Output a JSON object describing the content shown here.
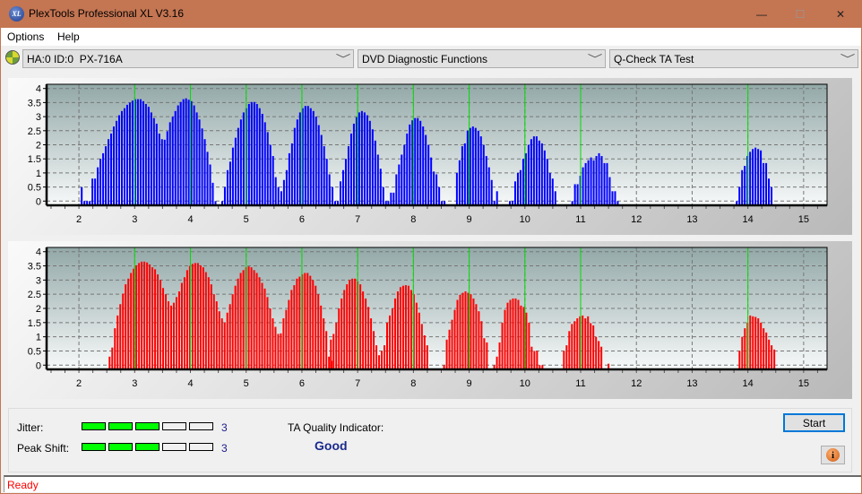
{
  "window": {
    "title": "PlexTools Professional XL V3.16",
    "logo_text": "XL",
    "controls": {
      "minimize": "—",
      "maximize": "☐",
      "close": "✕"
    }
  },
  "menu": {
    "items": [
      {
        "label": "Options"
      },
      {
        "label": "Help"
      }
    ]
  },
  "toolbar": {
    "drive_icon": "disc-drive-icon",
    "drive_select": "HA:0 ID:0  PX-716A",
    "function_select": "DVD Diagnostic Functions",
    "test_select": "Q-Check TA Test",
    "chevron": "﹀"
  },
  "chart_data": [
    {
      "type": "bar",
      "name": "TA land/pit jitter distribution (top)",
      "color": "#0000ff",
      "xlim": [
        1.42,
        15.42
      ],
      "ylim": [
        -0.15,
        4.15
      ],
      "x_ticks": [
        2,
        3,
        4,
        5,
        6,
        7,
        8,
        9,
        10,
        11,
        12,
        13,
        14,
        15
      ],
      "y_ticks": [
        0,
        0.5,
        1,
        1.5,
        2,
        2.5,
        3,
        3.5,
        4
      ],
      "y_tick_labels": [
        "0",
        "0.5",
        "1",
        "1.5",
        "2",
        "2.5",
        "3",
        "3.5",
        "4"
      ],
      "grid": true,
      "reference_lines": [
        3,
        4,
        5,
        6,
        7,
        8,
        9,
        10,
        11,
        14
      ],
      "step": 0.048,
      "clusters": [
        {
          "start": 2.05,
          "values": [
            0.5,
            0,
            0,
            0,
            0.8,
            0.8,
            1.2,
            1.5,
            1.7,
            1.95,
            2.2,
            2.4,
            2.65,
            2.85,
            3.05,
            3.2,
            3.3,
            3.42,
            3.5,
            3.57,
            3.62,
            3.62,
            3.62,
            3.55,
            3.45,
            3.35,
            3.15,
            2.95,
            2.75,
            2.4,
            2.2,
            2.18,
            2.48,
            2.8,
            3.0,
            3.2,
            3.4,
            3.52,
            3.62,
            3.65,
            3.6,
            3.55,
            3.4,
            3.15,
            2.9,
            2.58,
            2.2,
            1.75,
            1.3,
            0.65
          ]
        },
        {
          "start": 4.45,
          "values": [
            0
          ]
        },
        {
          "start": 4.57,
          "values": [
            0,
            0.5,
            1.1,
            1.4,
            1.9,
            2.25,
            2.6,
            2.9,
            3.15,
            3.3,
            3.45,
            3.52,
            3.52,
            3.45,
            3.3,
            3.1,
            2.8,
            2.45,
            2.0,
            1.6,
            0.85,
            0.5
          ]
        },
        {
          "start": 5.63,
          "values": [
            0.35,
            0.75,
            1.1,
            1.7,
            2.05,
            2.6,
            2.9,
            3.15,
            3.3,
            3.38,
            3.38,
            3.3,
            3.2,
            3.0,
            2.7,
            2.35,
            1.95,
            1.5,
            0.95
          ]
        },
        {
          "start": 6.5,
          "values": [
            0.5,
            0.5,
            0,
            0,
            0.7,
            1.1,
            1.5,
            1.95,
            2.4,
            2.75,
            2.98,
            3.15,
            3.2,
            3.15,
            3.05,
            2.85,
            2.55,
            2.15,
            1.65,
            1.15,
            0.5,
            0
          ]
        },
        {
          "start": 7.55,
          "values": [
            0,
            0.3,
            0.3,
            0.95,
            1.3,
            1.65,
            2.0,
            2.4,
            2.72,
            2.87,
            2.95,
            2.95,
            2.85,
            2.65,
            2.35,
            2.0,
            1.55,
            1.05,
            0.95,
            0.5,
            0,
            0
          ]
        },
        {
          "start": 8.78,
          "values": [
            1.0,
            1.45,
            1.95,
            2.05,
            2.5,
            2.6,
            2.65,
            2.6,
            2.5,
            2.3,
            2.0,
            1.6,
            1.2,
            0.75,
            0,
            0.35
          ]
        },
        {
          "start": 9.73,
          "values": [
            0,
            0,
            0.7,
            1.0,
            1.1,
            1.5,
            1.7,
            2.0,
            2.2,
            2.3,
            2.3,
            2.15,
            2.05,
            1.8,
            1.5,
            1.0,
            0.8,
            0.35
          ]
        },
        {
          "start": 10.85,
          "values": [
            0,
            0.6,
            0.6,
            0.9,
            1.2,
            1.35,
            1.45,
            1.55,
            1.45,
            1.6,
            1.7,
            1.6,
            1.35,
            1.35,
            0.85,
            0.35,
            0.35,
            0
          ]
        },
        {
          "start": 13.8,
          "values": [
            0,
            0.5,
            1.1,
            1.25,
            1.6,
            1.75,
            1.85,
            1.9,
            1.85,
            1.8,
            1.35,
            1.35,
            0.8,
            0.5
          ]
        }
      ]
    },
    {
      "type": "bar",
      "name": "TA land/pit jitter distribution (bottom)",
      "color": "#ff0000",
      "xlim": [
        1.42,
        15.42
      ],
      "ylim": [
        -0.15,
        4.15
      ],
      "x_ticks": [
        2,
        3,
        4,
        5,
        6,
        7,
        8,
        9,
        10,
        11,
        12,
        13,
        14,
        15
      ],
      "y_ticks": [
        0,
        0.5,
        1,
        1.5,
        2,
        2.5,
        3,
        3.5,
        4
      ],
      "y_tick_labels": [
        "0",
        "0.5",
        "1",
        "1.5",
        "2",
        "2.5",
        "3",
        "3.5",
        "4"
      ],
      "grid": true,
      "reference_lines": [
        3,
        4,
        5,
        6,
        7,
        8,
        9,
        10,
        11,
        14
      ],
      "step": 0.048,
      "clusters": [
        {
          "start": 2.55,
          "values": [
            0.3,
            0.62,
            1.3,
            1.75,
            2.15,
            2.52,
            2.85,
            3.05,
            3.25,
            3.4,
            3.52,
            3.6,
            3.65,
            3.65,
            3.62,
            3.55,
            3.45,
            3.38,
            3.2,
            3.0,
            2.72,
            2.5,
            2.25,
            2.1,
            2.2,
            2.4,
            2.6,
            2.9,
            3.1,
            3.35,
            3.5,
            3.57,
            3.6,
            3.6,
            3.52,
            3.45,
            3.28,
            3.1,
            2.85,
            2.5,
            2.25,
            1.9,
            1.65,
            1.5,
            1.85,
            2.15,
            2.5,
            2.8,
            3.05,
            3.25,
            3.35,
            3.45,
            3.48,
            3.45,
            3.35,
            3.25,
            3.1,
            2.9,
            2.7,
            2.4,
            2.0,
            1.65,
            1.35,
            1.1,
            1.12,
            1.65,
            1.95,
            2.3,
            2.65,
            2.82,
            3.05,
            3.12,
            3.2,
            3.25,
            3.25,
            3.15,
            3.0,
            2.8,
            2.5,
            2.1,
            1.65,
            1.2,
            0.3,
            0.15
          ]
        },
        {
          "start": 6.52,
          "values": [
            0.9,
            1.1,
            1.5,
            2.0,
            2.35,
            2.65,
            2.85,
            3.0,
            3.05,
            3.05,
            2.95,
            2.85,
            2.6,
            2.35,
            2.05,
            1.65,
            1.2,
            0.7,
            0.35,
            0.5,
            0.7,
            1.5,
            1.75,
            2.0,
            2.35,
            2.6,
            2.75,
            2.8,
            2.82,
            2.8,
            2.65,
            2.5,
            2.2,
            1.85,
            1.45,
            1.05,
            0.7
          ]
        },
        {
          "start": 8.55,
          "values": [
            0,
            0.9,
            1.25,
            1.6,
            1.95,
            2.3,
            2.48,
            2.55,
            2.6,
            2.55,
            2.5,
            2.35,
            2.15,
            1.9,
            1.55,
            0.95,
            0.8
          ]
        },
        {
          "start": 9.45,
          "values": [
            0,
            0.3,
            0.8,
            1.5,
            1.95,
            2.2,
            2.3,
            2.35,
            2.35,
            2.3,
            2.1,
            2.05,
            1.85,
            1.5,
            0.65,
            0.5,
            0.5,
            0,
            0
          ]
        },
        {
          "start": 10.7,
          "values": [
            0.5,
            0.7,
            1.2,
            1.45,
            1.55,
            1.65,
            1.72,
            1.75,
            1.65,
            1.72,
            1.48,
            1.4,
            1.0,
            0.85,
            0.65
          ]
        },
        {
          "start": 11.5,
          "values": [
            0.05
          ]
        },
        {
          "start": 13.85,
          "values": [
            0.5,
            1.0,
            1.3,
            1.5,
            1.75,
            1.72,
            1.7,
            1.65,
            1.5,
            1.3,
            1.15,
            0.9,
            0.7,
            0.55
          ]
        }
      ]
    }
  ],
  "metrics": {
    "jitter": {
      "label": "Jitter:",
      "value": "3",
      "segments_on": 3,
      "segments_total": 5
    },
    "peak_shift": {
      "label": "Peak Shift:",
      "value": "3",
      "segments_on": 3,
      "segments_total": 5
    },
    "ta_quality_label": "TA Quality Indicator:",
    "ta_quality_value": "Good"
  },
  "buttons": {
    "start": "Start",
    "info_icon": "i"
  },
  "status": {
    "text": "Ready"
  }
}
